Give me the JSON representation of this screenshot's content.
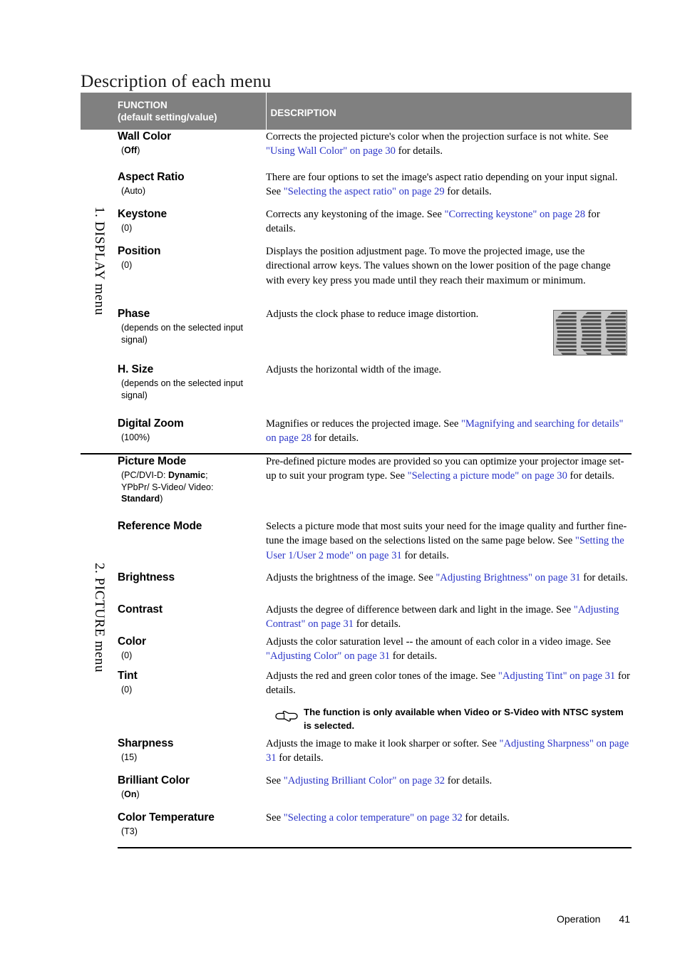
{
  "page": {
    "title": "Description of each menu",
    "footer": {
      "section": "Operation",
      "page_number": "41"
    }
  },
  "table": {
    "header": {
      "function_line1": "FUNCTION",
      "function_line2": "(default setting/value)",
      "description": "DESCRIPTION"
    },
    "sections": [
      {
        "side_label": "1. DISPLAY menu",
        "rows": [
          {
            "name": "Wall Color",
            "default": "(Off)",
            "default_html": "(<b>Off</b>)",
            "description_html": "Corrects the projected picture's color when the projection surface is not white. See <span class=\"xref\">\"Using Wall Color\" on page 30</span> for details.",
            "description_text": "Corrects the projected picture's color when the projection surface is not white. See \"Using Wall Color\" on page 30 for details.",
            "xrefs": [
              "\"Using Wall Color\" on page 30"
            ]
          },
          {
            "name": "Aspect Ratio",
            "default": "(Auto)",
            "default_html": "(Auto)",
            "description_html": "There are four options to set the image's aspect ratio depending on your input signal. See <span class=\"xref\">\"Selecting the aspect ratio\" on page 29</span> for details.",
            "description_text": "There are four options to set the image's aspect ratio depending on your input signal. See \"Selecting the aspect ratio\" on page 29 for details.",
            "xrefs": [
              "\"Selecting the aspect ratio\" on page 29"
            ]
          },
          {
            "name": "Keystone",
            "default": "(0)",
            "default_html": "(0)",
            "description_html": "Corrects any keystoning of the image. See <span class=\"xref\">\"Correcting keystone\" on page 28</span> for details.",
            "description_text": "Corrects any keystoning of the image. See \"Correcting keystone\" on page 28 for details.",
            "xrefs": [
              "\"Correcting keystone\" on page 28"
            ]
          },
          {
            "name": "Position",
            "default": "(0)",
            "default_html": "(0)",
            "description_html": "Displays the position adjustment page. To move the projected image, use the directional arrow keys. The values shown on the lower position of the page change with every key press you made until they reach their maximum or minimum.",
            "description_text": "Displays the position adjustment page. To move the projected image, use the directional arrow keys. The values shown on the lower position of the page change with every key press you made until they reach their maximum or minimum.",
            "xrefs": []
          },
          {
            "name": "Phase",
            "default": "(depends on the selected input signal)",
            "default_html": "(depends on the selected input signal)",
            "description_html": "Adjusts the clock phase to reduce image distortion.",
            "description_text": "Adjusts the clock phase to reduce image distortion.",
            "thumbnail": "phase-distortion-pattern",
            "xrefs": []
          },
          {
            "name": "H. Size",
            "default": "(depends on the selected input signal)",
            "default_html": "(depends on the selected input signal)",
            "description_html": "Adjusts the horizontal width of the image.",
            "description_text": "Adjusts the horizontal width of the image.",
            "xrefs": []
          },
          {
            "name": "Digital Zoom",
            "default": "(100%)",
            "default_html": "(100%)",
            "description_html": "Magnifies or reduces the projected image. See <span class=\"xref\">\"Magnifying and searching for details\" on page 28</span> for details.",
            "description_text": "Magnifies or reduces the projected image. See \"Magnifying and searching for details\" on page 28 for details.",
            "xrefs": [
              "\"Magnifying and searching for details\" on page 28"
            ]
          }
        ]
      },
      {
        "side_label": "2. PICTURE menu",
        "rows": [
          {
            "name": "Picture Mode",
            "default": "(PC/DVI-D: Dynamic; YPbPr/ S-Video/ Video: Standard)",
            "default_html": "(PC/DVI-D: <b>Dynamic</b>;<br>YPbPr/ S-Video/ Video:<br><b>Standard</b>)",
            "description_html": "Pre-defined picture modes are provided so you can optimize your projector image set-up to suit your program type. See <span class=\"xref\">\"Selecting a picture mode\" on page 30</span> for details.",
            "description_text": "Pre-defined picture modes are provided so you can optimize your projector image set-up to suit your program type. See \"Selecting a picture mode\" on page 30 for details.",
            "xrefs": [
              "\"Selecting a picture mode\" on page 30"
            ]
          },
          {
            "name": "Reference Mode",
            "default": "",
            "default_html": "",
            "description_html": "Selects a picture mode that most suits your need for the image quality and further fine-tune the image based on the selections listed on the same page below. See <span class=\"xref\">\"Setting the User 1/User 2 mode\" on page 31</span> for details.",
            "description_text": "Selects a picture mode that most suits your need for the image quality and further fine-tune the image based on the selections listed on the same page below. See \"Setting the User 1/User 2 mode\" on page 31 for details.",
            "xrefs": [
              "\"Setting the User 1/User 2 mode\" on page 31"
            ]
          },
          {
            "name": "Brightness",
            "default": "",
            "default_html": "",
            "description_html": "Adjusts the brightness of the image. See <span class=\"xref\">\"Adjusting Brightness\" on page 31</span> for details.",
            "description_text": "Adjusts the brightness of the image. See \"Adjusting Brightness\" on page 31 for details.",
            "xrefs": [
              "\"Adjusting Brightness\" on page 31"
            ]
          },
          {
            "name": "Contrast",
            "default": "",
            "default_html": "",
            "description_html": "Adjusts the degree of difference between dark and light in the image. See <span class=\"xref\">\"Adjusting Contrast\" on page 31</span> for details.",
            "description_text": "Adjusts the degree of difference between dark and light in the image. See \"Adjusting Contrast\" on page 31 for details.",
            "xrefs": [
              "\"Adjusting Contrast\" on page 31"
            ]
          },
          {
            "name": "Color",
            "default": "(0)",
            "default_html": "(0)",
            "description_html": "Adjusts the color saturation level -- the amount of each color in a video image. See <span class=\"xref\">\"Adjusting Color\" on page 31</span> for details.",
            "description_text": "Adjusts the color saturation level -- the amount of each color in a video image. See \"Adjusting Color\" on page 31 for details.",
            "xrefs": [
              "\"Adjusting Color\" on page 31"
            ]
          },
          {
            "name": "Tint",
            "default": "(0)",
            "default_html": "(0)",
            "description_html": "Adjusts the red and green color tones of the image. See <span class=\"xref\">\"Adjusting Tint\" on page 31</span> for details.",
            "description_text": "Adjusts the red and green color tones of the image. See \"Adjusting Tint\" on page 31 for details.",
            "xrefs": [
              "\"Adjusting Tint\" on page 31"
            ],
            "note": "The function is only available when Video or S-Video with NTSC system is selected.",
            "note_icon": "pointing-hand-icon"
          },
          {
            "name": "Sharpness",
            "default": "(15)",
            "default_html": "(15)",
            "description_html": "Adjusts the image to make it look sharper or softer. See <span class=\"xref\">\"Adjusting Sharpness\" on page 31</span> for details.",
            "description_text": "Adjusts the image to make it look sharper or softer. See \"Adjusting Sharpness\" on page 31 for details.",
            "xrefs": [
              "\"Adjusting Sharpness\" on page 31"
            ]
          },
          {
            "name": "Brilliant Color",
            "default": "(On)",
            "default_html": "(<b>On</b>)",
            "description_html": "See <span class=\"xref\">\"Adjusting Brilliant Color\" on page 32</span> for details.",
            "description_text": "See \"Adjusting Brilliant Color\" on page 32 for details.",
            "xrefs": [
              "\"Adjusting Brilliant Color\" on page 32"
            ]
          },
          {
            "name": "Color Temperature",
            "default": "(T3)",
            "default_html": "(T3)",
            "description_html": "See <span class=\"xref\">\"Selecting a color temperature\" on page 32</span> for details.",
            "description_text": "See \"Selecting a color temperature\" on page 32 for details.",
            "xrefs": [
              "\"Selecting a color temperature\" on page 32"
            ]
          }
        ]
      }
    ]
  },
  "colors": {
    "header_background": "#808080",
    "header_text": "#ffffff",
    "cross_reference_link": "#2b35c8",
    "body_text": "#000000",
    "thumbnail_background": "#c6c6c6",
    "thumbnail_stripe": "#4d4d4d"
  }
}
